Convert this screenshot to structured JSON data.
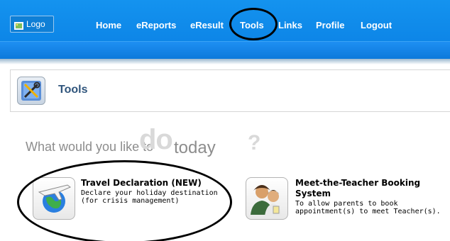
{
  "header": {
    "logo_label": "Logo",
    "nav": [
      {
        "label": "Home"
      },
      {
        "label": "eReports"
      },
      {
        "label": "eResult"
      },
      {
        "label": "Tools"
      },
      {
        "label": "Links"
      },
      {
        "label": "Profile"
      },
      {
        "label": "Logout"
      }
    ],
    "active_item": "Tools"
  },
  "section": {
    "title": "Tools",
    "icon": "tools-icon"
  },
  "prompt": {
    "part1": "What would you like to",
    "part2": "do",
    "part3": "today",
    "part4": "?"
  },
  "tools": [
    {
      "title": "Travel Declaration (NEW)",
      "description_lines": [
        "Declare your holiday destination",
        "(for crisis management)"
      ],
      "icon": "travel-globe-icon"
    },
    {
      "title_lines": [
        "Meet-the-Teacher Booking",
        "System"
      ],
      "description_lines": [
        "To allow parents to book",
        "appointment(s) to meet Teacher(s)."
      ],
      "icon": "parent-teacher-icon"
    }
  ],
  "colors": {
    "header_blue": "#0a80e4",
    "section_title": "#30557c",
    "annotation": "#000000"
  }
}
